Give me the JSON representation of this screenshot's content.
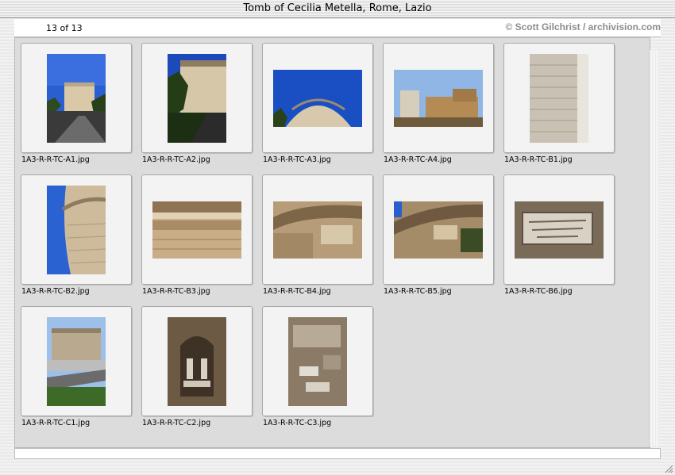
{
  "window": {
    "title": "Tomb of Cecilia Metella, Rome, Lazio"
  },
  "header": {
    "counter": "13 of 13",
    "credit": "© Scott Gilchrist / archivision.com"
  },
  "thumbnails": [
    {
      "filename": "1A3-R-R-TC-A1.jpg",
      "orientation": "portrait"
    },
    {
      "filename": "1A3-R-R-TC-A2.jpg",
      "orientation": "portrait"
    },
    {
      "filename": "1A3-R-R-TC-A3.jpg",
      "orientation": "landscape"
    },
    {
      "filename": "1A3-R-R-TC-A4.jpg",
      "orientation": "landscape"
    },
    {
      "filename": "1A3-R-R-TC-B1.jpg",
      "orientation": "portrait"
    },
    {
      "filename": "1A3-R-R-TC-B2.jpg",
      "orientation": "portrait"
    },
    {
      "filename": "1A3-R-R-TC-B3.jpg",
      "orientation": "landscape"
    },
    {
      "filename": "1A3-R-R-TC-B4.jpg",
      "orientation": "landscape"
    },
    {
      "filename": "1A3-R-R-TC-B5.jpg",
      "orientation": "landscape"
    },
    {
      "filename": "1A3-R-R-TC-B6.jpg",
      "orientation": "landscape"
    },
    {
      "filename": "1A3-R-R-TC-C1.jpg",
      "orientation": "portrait"
    },
    {
      "filename": "1A3-R-R-TC-C2.jpg",
      "orientation": "portrait"
    },
    {
      "filename": "1A3-R-R-TC-C3.jpg",
      "orientation": "portrait"
    }
  ],
  "colors": {
    "sky": "#1f55c8",
    "stone": "#cdbfa6",
    "foliage": "#2f4b1e",
    "panel": "#dcdcdc"
  }
}
